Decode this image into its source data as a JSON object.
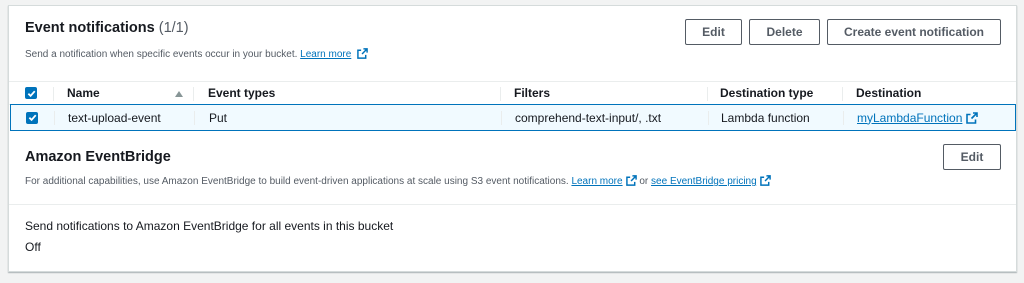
{
  "event_notifications": {
    "title": "Event notifications",
    "count": "(1/1)",
    "description": "Send a notification when specific events occur in your bucket.",
    "learn_more": "Learn more",
    "buttons": {
      "edit": "Edit",
      "delete": "Delete",
      "create": "Create event notification"
    },
    "columns": [
      "Name",
      "Event types",
      "Filters",
      "Destination type",
      "Destination"
    ],
    "rows": [
      {
        "selected": true,
        "name": "text-upload-event",
        "event_types": "Put",
        "filters": "comprehend-text-input/, .txt",
        "destination_type": "Lambda function",
        "destination": "myLambdaFunction"
      }
    ]
  },
  "eventbridge": {
    "title": "Amazon EventBridge",
    "edit": "Edit",
    "description": "For additional capabilities, use Amazon EventBridge to build event-driven applications at scale using S3 event notifications.",
    "learn_more": "Learn more",
    "or": "or",
    "pricing_link": "see EventBridge pricing",
    "setting_label": "Send notifications to Amazon EventBridge for all events in this bucket",
    "setting_value": "Off"
  },
  "colors": {
    "link": "#0073bb",
    "selected_row_bg": "#f1faff",
    "selected_row_border": "#0073bb",
    "checkbox": "#0073bb"
  }
}
